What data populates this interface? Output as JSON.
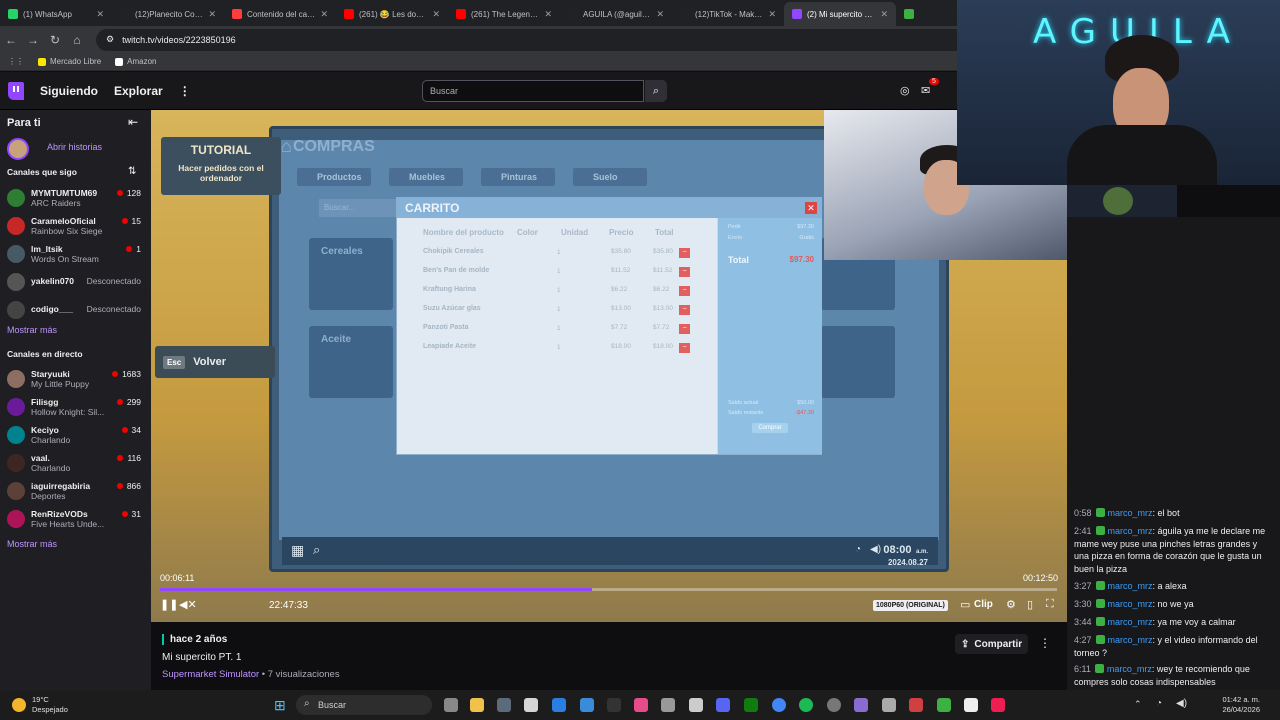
{
  "tabs": [
    {
      "label": "(1) WhatsApp",
      "color": "#25d366",
      "active": false
    },
    {
      "label": "(12)Planecito Cool :3",
      "color": "#222222",
      "active": false
    },
    {
      "label": "Contenido del canal",
      "color": "#ff3d3d",
      "active": false
    },
    {
      "label": "(261) 😂 Les doy DI",
      "color": "#ff0000",
      "active": false
    },
    {
      "label": "(261) The Legend Of",
      "color": "#ff0000",
      "active": false
    },
    {
      "label": "AGUILA (@aguila72",
      "color": "#222222",
      "active": false
    },
    {
      "label": "(12)TikTok - Make Yo",
      "color": "#222222",
      "active": false
    },
    {
      "label": "(2) Mi supercito PT.",
      "color": "#9147ff",
      "active": true
    },
    {
      "label": "Str",
      "color": "#3cb043",
      "active": false
    }
  ],
  "browser": {
    "url": "twitch.tv/videos/2223850196",
    "bookmarks": [
      "Mercado Libre",
      "Amazon"
    ]
  },
  "topnav": {
    "following": "Siguiendo",
    "browse": "Explorar",
    "more": "⋮",
    "search_placeholder": "Buscar",
    "notif_count": "5"
  },
  "sidebar": {
    "for_you": "Para ti",
    "open_stories": "Abrir historias",
    "followed_heading": "Canales que sigo",
    "followed": [
      {
        "name": "MYMTUMTUM69",
        "game": "ARC Raiders",
        "viewers": "128",
        "live": true,
        "color": "#2e7d32"
      },
      {
        "name": "CarameloOficial",
        "game": "Rainbow Six Siege",
        "viewers": "15",
        "live": true,
        "color": "#c62828"
      },
      {
        "name": "lm_ltsik",
        "game": "Words On Stream",
        "viewers": "1",
        "live": true,
        "color": "#455a64"
      },
      {
        "name": "yakelin070",
        "game": "",
        "status": "Desconectado",
        "live": false,
        "color": "#555555"
      },
      {
        "name": "codigo___",
        "game": "",
        "status": "Desconectado",
        "live": false,
        "color": "#444444"
      }
    ],
    "show_more_1": "Mostrar más",
    "live_heading": "Canales en directo",
    "live_channels": [
      {
        "name": "Staryuuki",
        "game": "My Little Puppy",
        "viewers": "1683",
        "color": "#8d6e63"
      },
      {
        "name": "Filisgg",
        "game": "Hollow Knight: Sil...",
        "viewers": "299",
        "color": "#6a1b9a"
      },
      {
        "name": "Keciyo",
        "game": "Charlando",
        "viewers": "34",
        "color": "#00838f"
      },
      {
        "name": "vaal.",
        "game": "Charlando",
        "viewers": "116",
        "color": "#3e2723"
      },
      {
        "name": "iaguirregabiria",
        "game": "Deportes",
        "viewers": "866",
        "color": "#5d4037"
      },
      {
        "name": "RenRizeVODs",
        "game": "Five Hearts Unde...",
        "viewers": "31",
        "color": "#ad1457"
      }
    ],
    "show_more_2": "Mostrar más"
  },
  "game": {
    "tutorial_title": "TUTORIAL",
    "tutorial_text": "Hacer pedidos con el ordenador",
    "back_key": "Esc",
    "back_label": "Volver",
    "compras_title": "COMPRAS",
    "categories": [
      "Productos",
      "Muebles",
      "Pinturas",
      "Suelo"
    ],
    "search_placeholder": "Buscar...",
    "cards_left": [
      "Cereales",
      "Aceite"
    ],
    "carrito": {
      "title": "CARRITO",
      "close": "✕",
      "headers": [
        "Nombre del producto",
        "Color",
        "Unidad",
        "Precio",
        "Total"
      ],
      "rows": [
        {
          "name": "Chokipik Cereales",
          "qty": "1",
          "price": "$35.80",
          "total": "$35.80"
        },
        {
          "name": "Ben's Pan de molde",
          "qty": "1",
          "price": "$11.52",
          "total": "$11.52"
        },
        {
          "name": "Kraftung Harina",
          "qty": "1",
          "price": "$6.22",
          "total": "$6.22"
        },
        {
          "name": "Suzu Azúcar glas",
          "qty": "1",
          "price": "$13.00",
          "total": "$13.00"
        },
        {
          "name": "Panzoti Pasta",
          "qty": "1",
          "price": "$7.72",
          "total": "$7.72"
        },
        {
          "name": "Leapiade Aceite",
          "qty": "1",
          "price": "$18.00",
          "total": "$18.00"
        }
      ],
      "summary_pedir_label": "Pedir",
      "summary_pedir_value": "$97.30",
      "summary_envio_label": "Envío",
      "summary_envio_value": "Gratis",
      "total_label": "Total",
      "total_value": "$97.30",
      "saldo_actual_label": "Saldo actual",
      "saldo_actual_value": "$50.00",
      "saldo_restante_label": "Saldo restante",
      "saldo_restante_value": "-$47.30",
      "buy_label": "Comprar"
    },
    "clock_time": "08:00",
    "clock_ampm": "a.m.",
    "clock_date": "2024.08.27"
  },
  "player": {
    "time_current": "00:06:11",
    "time_total": "00:12:50",
    "progress": 0.482,
    "clock": "22:47:33",
    "quality": "1080P60 (ORIGINAL)",
    "clip_label": "Clip"
  },
  "video_info": {
    "ago": "hace 2 años",
    "title": "Mi supercito PT. 1",
    "game": "Supermarket Simulator",
    "views": " • 7 visualizaciones",
    "share": "Compartir"
  },
  "stream_overlay": {
    "neon": "AGUILA"
  },
  "chat": [
    {
      "ts": "0:58",
      "user": "marco_mrz",
      "text": ": el bot"
    },
    {
      "ts": "2:41",
      "user": "marco_mrz",
      "text": ": águila ya me le declare me mame wey puse una pinches letras grandes y una pizza en forma de corazón que le gusta un buen la pizza"
    },
    {
      "ts": "3:27",
      "user": "marco_mrz",
      "text": ": a alexa"
    },
    {
      "ts": "3:30",
      "user": "marco_mrz",
      "text": ": no we ya"
    },
    {
      "ts": "3:44",
      "user": "marco_mrz",
      "text": ": ya me voy a calmar"
    },
    {
      "ts": "4:27",
      "user": "marco_mrz",
      "text": ": y el video informando del torneo ?"
    },
    {
      "ts": "6:11",
      "user": "marco_mrz",
      "text": ": wey te recomiendo que compres solo cosas indispensables"
    }
  ],
  "taskbar": {
    "temp": "19°C",
    "weather": "Despejado",
    "search": "Buscar",
    "time": "01:42 a. m.",
    "date": "26/04/2026",
    "lang": "ESP"
  }
}
